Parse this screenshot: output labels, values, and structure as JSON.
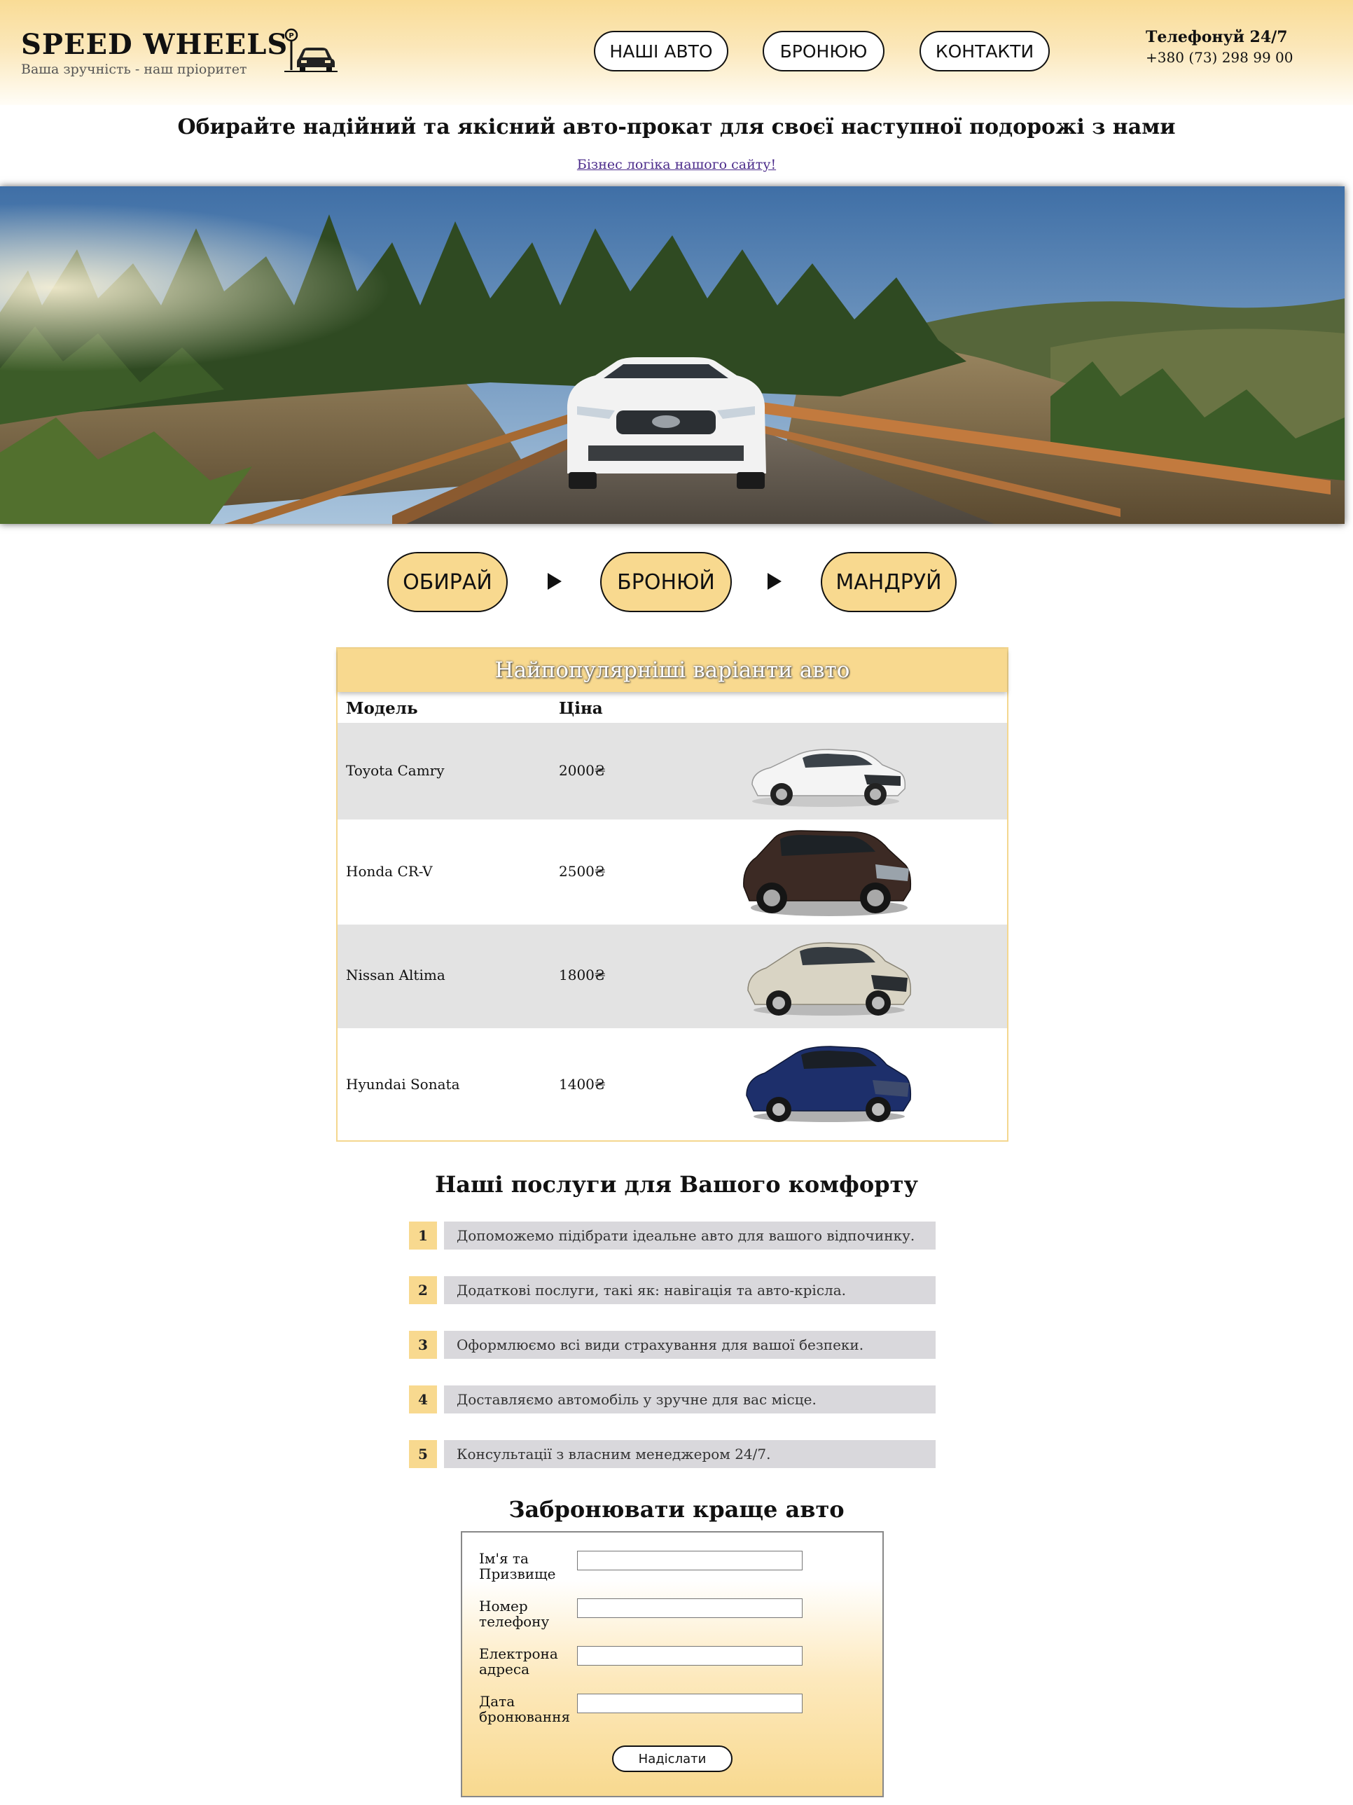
{
  "header": {
    "brand": "SPEED WHEELS",
    "slogan": "Ваша зручність - наш пріоритет",
    "nav": [
      "НАШІ АВТО",
      "БРОНЮЮ",
      "КОНТАКТИ"
    ],
    "phone_title": "Телефонуй 24/7",
    "phone_number": "+380 (73) 298 99 00"
  },
  "tagline": "Обирайте надійний та якісний авто-прокат для своєї наступної подорожі з нами",
  "business_link": "Бізнес логіка нашого сайту!",
  "hero_image": "white crossover on a mountain bridge among pine trees",
  "steps": [
    "ОБИРАЙ",
    "БРОНЮЙ",
    "МАНДРУЙ"
  ],
  "cars": {
    "title": "Найпопулярніші варіанти авто",
    "columns": [
      "Модель",
      "Ціна"
    ],
    "rows": [
      {
        "model": "Toyota Camry",
        "price": "2000₴",
        "color": "#f2f2f2"
      },
      {
        "model": "Honda CR-V",
        "price": "2500₴",
        "color": "#3c2a24"
      },
      {
        "model": "Nissan Altima",
        "price": "1800₴",
        "color": "#d9d4c4"
      },
      {
        "model": "Hyundai Sonata",
        "price": "1400₴",
        "color": "#1d2f6b"
      }
    ]
  },
  "services": {
    "title": "Наші послуги для Вашого комфорту",
    "items": [
      {
        "num": "1",
        "text": "Допоможемо підібрати ідеальне авто для вашого відпочинку."
      },
      {
        "num": "2",
        "text": "Додаткові послуги, такі як: навігація та авто-крісла."
      },
      {
        "num": "3",
        "text": "Оформлюємо всі види страхування для вашої безпеки."
      },
      {
        "num": "4",
        "text": "Доставляємо автомобіль у зручне для вас місце."
      },
      {
        "num": "5",
        "text": "Консультації з власним менеджером 24/7."
      }
    ]
  },
  "booking": {
    "title": "Забронювати краще авто",
    "fields": [
      {
        "label_1": "Ім'я та",
        "label_2": "Призвище",
        "value": ""
      },
      {
        "label_1": "Номер",
        "label_2": "телефону",
        "value": ""
      },
      {
        "label_1": "Електрона",
        "label_2": "адреса",
        "value": ""
      },
      {
        "label_1": "Дата",
        "label_2": "бронювання",
        "value": ""
      }
    ],
    "submit": "Надіслати"
  },
  "colors": {
    "accent": "#f8d98f",
    "service_bg": "#d9d8dc",
    "row_alt": "#e3e3e3",
    "link": "#4b2b8a"
  }
}
